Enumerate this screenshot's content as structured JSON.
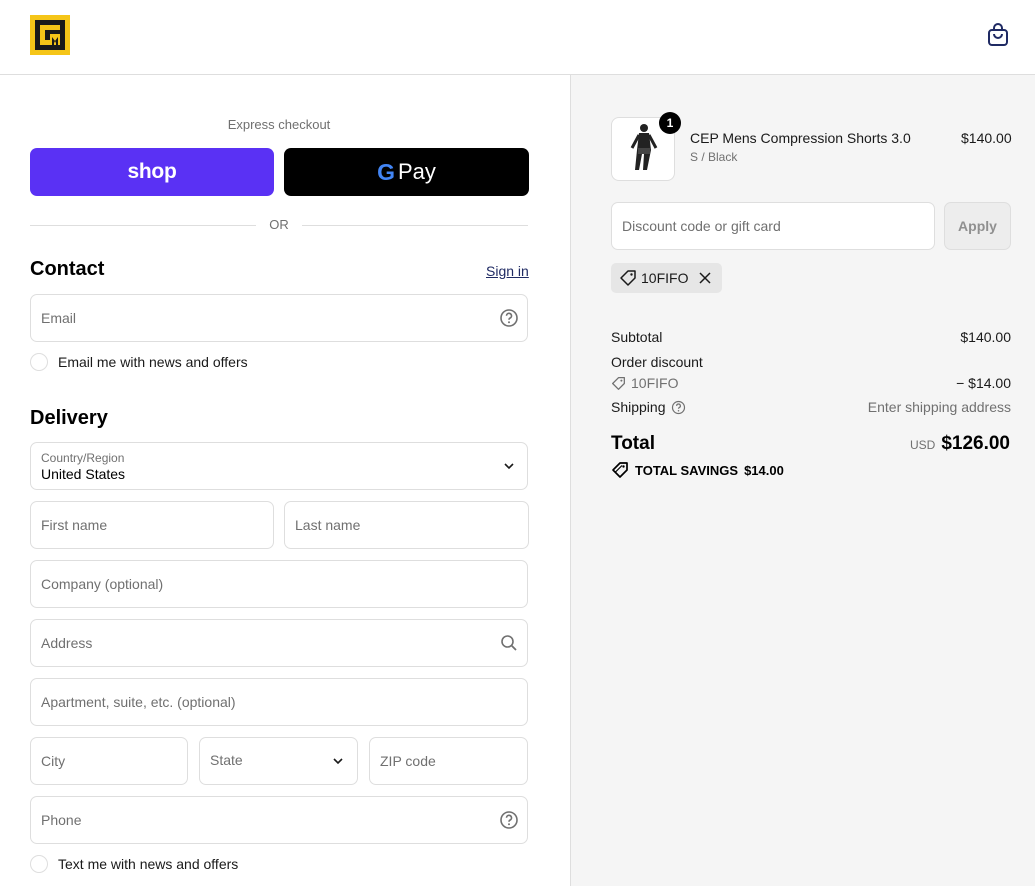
{
  "header": {
    "logo_icon": "store-logo",
    "cart_icon": "shopping-bag-icon"
  },
  "checkout": {
    "express_label": "Express checkout",
    "shop_button": "shop",
    "gpay_button_g": "G",
    "gpay_button_pay": "Pay",
    "or_label": "OR"
  },
  "contact": {
    "title": "Contact",
    "sign_in": "Sign in",
    "email_placeholder": "Email",
    "news_checkbox": "Email me with news and offers"
  },
  "delivery": {
    "title": "Delivery",
    "country_label": "Country/Region",
    "country_value": "United States",
    "first_name": "First name",
    "last_name": "Last name",
    "company": "Company (optional)",
    "address": "Address",
    "apartment": "Apartment, suite, etc. (optional)",
    "city": "City",
    "state": "State",
    "zip": "ZIP code",
    "phone": "Phone",
    "sms_checkbox": "Text me with news and offers"
  },
  "order": {
    "item_name": "CEP Mens Compression Shorts 3.0",
    "item_variant": "S / Black",
    "item_price": "$140.00",
    "item_qty": "1",
    "discount_placeholder": "Discount code or gift card",
    "apply_button": "Apply",
    "applied_code": "10FIFO"
  },
  "summary": {
    "subtotal_label": "Subtotal",
    "subtotal_value": "$140.00",
    "discount_label": "Order discount",
    "discount_code": "10FIFO",
    "discount_value": "− $14.00",
    "shipping_label": "Shipping",
    "shipping_value": "Enter shipping address",
    "total_label": "Total",
    "currency": "USD",
    "total_value": "$126.00",
    "savings_label": "TOTAL SAVINGS",
    "savings_value": "$14.00"
  },
  "colors": {
    "shop_purple": "#5a31f4",
    "border": "#dedede",
    "summary_bg": "#f5f5f5",
    "logo_yellow": "#f5c518"
  }
}
